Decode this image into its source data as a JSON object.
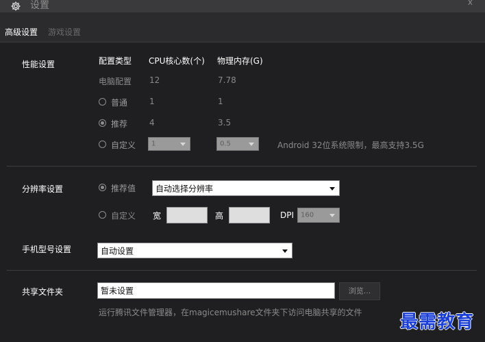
{
  "window": {
    "title": "设置",
    "close_label": "x",
    "icon": "gear-icon"
  },
  "tabs": [
    {
      "label": "高级设置",
      "active": true
    },
    {
      "label": "游戏设置",
      "active": false
    }
  ],
  "performance": {
    "section_label": "性能设置",
    "headers": {
      "config_type": "配置类型",
      "cpu": "CPU核心数(个)",
      "memory": "物理内存(G)"
    },
    "pc_row": {
      "label": "电脑配置",
      "cpu": "12",
      "memory": "7.78"
    },
    "normal_row": {
      "label": "普通",
      "cpu": "1",
      "memory": "1",
      "selected": false
    },
    "recommended_row": {
      "label": "推荐",
      "cpu": "4",
      "memory": "3.5",
      "selected": true
    },
    "custom_row": {
      "label": "自定义",
      "cpu_select": "1",
      "memory_select": "0.5",
      "selected": false,
      "note": "Android 32位系统限制，最高支持3.5G"
    }
  },
  "resolution": {
    "section_label": "分辨率设置",
    "recommended": {
      "label": "推荐值",
      "selected": true,
      "select_value": "自动选择分辨率"
    },
    "custom": {
      "label": "自定义",
      "selected": false,
      "width_label": "宽",
      "height_label": "高",
      "dpi_label": "DPI",
      "dpi_value": "160"
    }
  },
  "phone_model": {
    "section_label": "手机型号设置",
    "select_value": "自动设置"
  },
  "shared_folder": {
    "section_label": "共享文件夹",
    "field_value": "暂未设置",
    "browse_label": "浏览...",
    "hint": "运行腾讯文件管理器，在magicemushare文件夹下访问电脑共享的文件"
  },
  "watermark": "最需教育",
  "colors": {
    "background": "#1f1f21",
    "titlebar": "#3a3a3c",
    "watermark": "#1a3fd8"
  }
}
